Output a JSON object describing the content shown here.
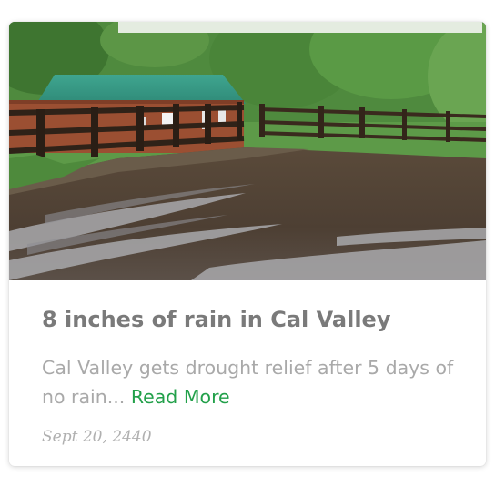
{
  "article": {
    "title": "8 inches of rain in Cal Valley",
    "description": "Cal Valley gets drought relief after 5 days of no rain...",
    "read_more_label": "Read More",
    "date": "Sept 20, 2440"
  },
  "colors": {
    "title": "#7a7a7a",
    "description": "#a9a9a9",
    "link": "#22a04a",
    "date": "#b0b0b0"
  }
}
